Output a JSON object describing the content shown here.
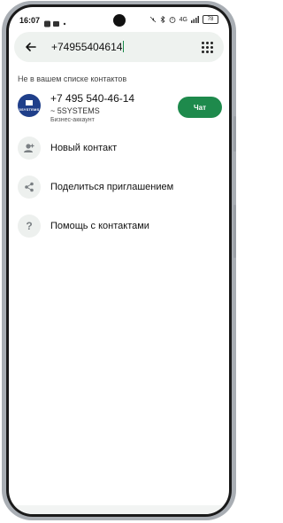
{
  "status_bar": {
    "time": "16:07",
    "signal": "4G",
    "battery": "78"
  },
  "search": {
    "value": "+74955404614"
  },
  "section": {
    "header": "Не в вашем списке контактов"
  },
  "contact": {
    "phone": "+7 495 540-46-14",
    "name": "~ 5SYSTEMS",
    "subtype": "Бизнес-аккаунт",
    "logo_text": "5SYSTEMS",
    "chat_label": "Чат"
  },
  "actions": [
    {
      "label": "Новый контакт",
      "icon": "add-person-icon"
    },
    {
      "label": "Поделиться приглашением",
      "icon": "share-icon"
    },
    {
      "label": "Помощь с контактами",
      "icon": "help-icon"
    }
  ],
  "colors": {
    "accent": "#1e8a4c",
    "logo": "#1f3f8a"
  }
}
